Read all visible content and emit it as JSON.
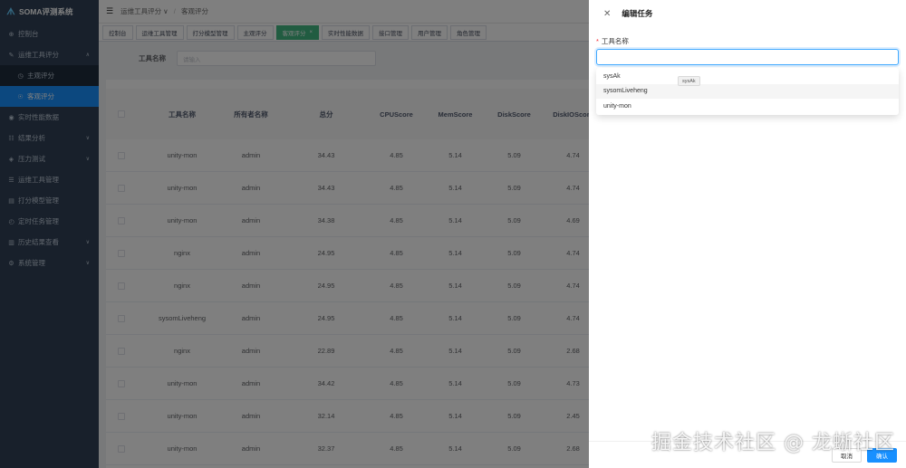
{
  "app": {
    "title": "SOMA评测系统"
  },
  "sidebar": {
    "items": [
      {
        "label": "控制台",
        "icon": "dashboard-icon"
      },
      {
        "label": "运维工具评分",
        "icon": "tool-icon",
        "expanded": true
      },
      {
        "label": "主观评分",
        "icon": "clock-icon",
        "sub": true
      },
      {
        "label": "客观评分",
        "icon": "user-icon",
        "sub": true,
        "active": true
      },
      {
        "label": "实时性能数据",
        "icon": "chart-icon"
      },
      {
        "label": "结果分析",
        "icon": "analysis-icon",
        "arrow": true
      },
      {
        "label": "压力测试",
        "icon": "stress-icon",
        "arrow": true
      },
      {
        "label": "运维工具管理",
        "icon": "list-icon"
      },
      {
        "label": "打分模型管理",
        "icon": "model-icon"
      },
      {
        "label": "定时任务管理",
        "icon": "timer-icon"
      },
      {
        "label": "历史结果查看",
        "icon": "history-icon",
        "arrow": true
      },
      {
        "label": "系统管理",
        "icon": "settings-icon",
        "arrow": true
      }
    ]
  },
  "navbar": {
    "crumb1": "运维工具评分",
    "crumb2": "客观评分"
  },
  "tags": [
    "控制台",
    "运维工具管理",
    "打分模型管理",
    "主观评分",
    "客观评分",
    "实时性能数据",
    "接口管理",
    "用户管理",
    "角色管理"
  ],
  "filter": {
    "label": "工具名称",
    "placeholder": "请输入"
  },
  "table": {
    "headers": [
      "工具名称",
      "所有者名称",
      "总分",
      "CPUScore",
      "MemScore",
      "DiskScore",
      "DiskIOScore"
    ],
    "rows": [
      [
        "unity-mon",
        "admin",
        "34.43",
        "4.85",
        "5.14",
        "5.09",
        "4.74"
      ],
      [
        "unity-mon",
        "admin",
        "34.43",
        "4.85",
        "5.14",
        "5.09",
        "4.74"
      ],
      [
        "unity-mon",
        "admin",
        "34.38",
        "4.85",
        "5.14",
        "5.09",
        "4.69"
      ],
      [
        "nginx",
        "admin",
        "24.95",
        "4.85",
        "5.14",
        "5.09",
        "4.74"
      ],
      [
        "nginx",
        "admin",
        "24.95",
        "4.85",
        "5.14",
        "5.09",
        "4.74"
      ],
      [
        "sysomLiveheng",
        "admin",
        "24.95",
        "4.85",
        "5.14",
        "5.09",
        "4.74"
      ],
      [
        "nginx",
        "admin",
        "22.89",
        "4.85",
        "5.14",
        "5.09",
        "2.68"
      ],
      [
        "unity-mon",
        "admin",
        "34.42",
        "4.85",
        "5.14",
        "5.09",
        "4.73"
      ],
      [
        "unity-mon",
        "admin",
        "32.14",
        "4.85",
        "5.14",
        "5.09",
        "2.45"
      ],
      [
        "unity-mon",
        "admin",
        "32.37",
        "4.85",
        "5.14",
        "5.09",
        "2.68"
      ]
    ]
  },
  "drawer": {
    "title": "编辑任务",
    "field_label": "工具名称",
    "required_mark": "*",
    "options": [
      "sysAk",
      "sysomLiveheng",
      "unity-mon"
    ],
    "tooltip": "sysAk",
    "cancel": "取消",
    "ok": "确认"
  },
  "watermark": "掘金技术社区 @ 龙蜥社区",
  "colors": {
    "sidebar_bg": "#304156",
    "active": "#1890ff",
    "active_tag": "#42b983"
  }
}
